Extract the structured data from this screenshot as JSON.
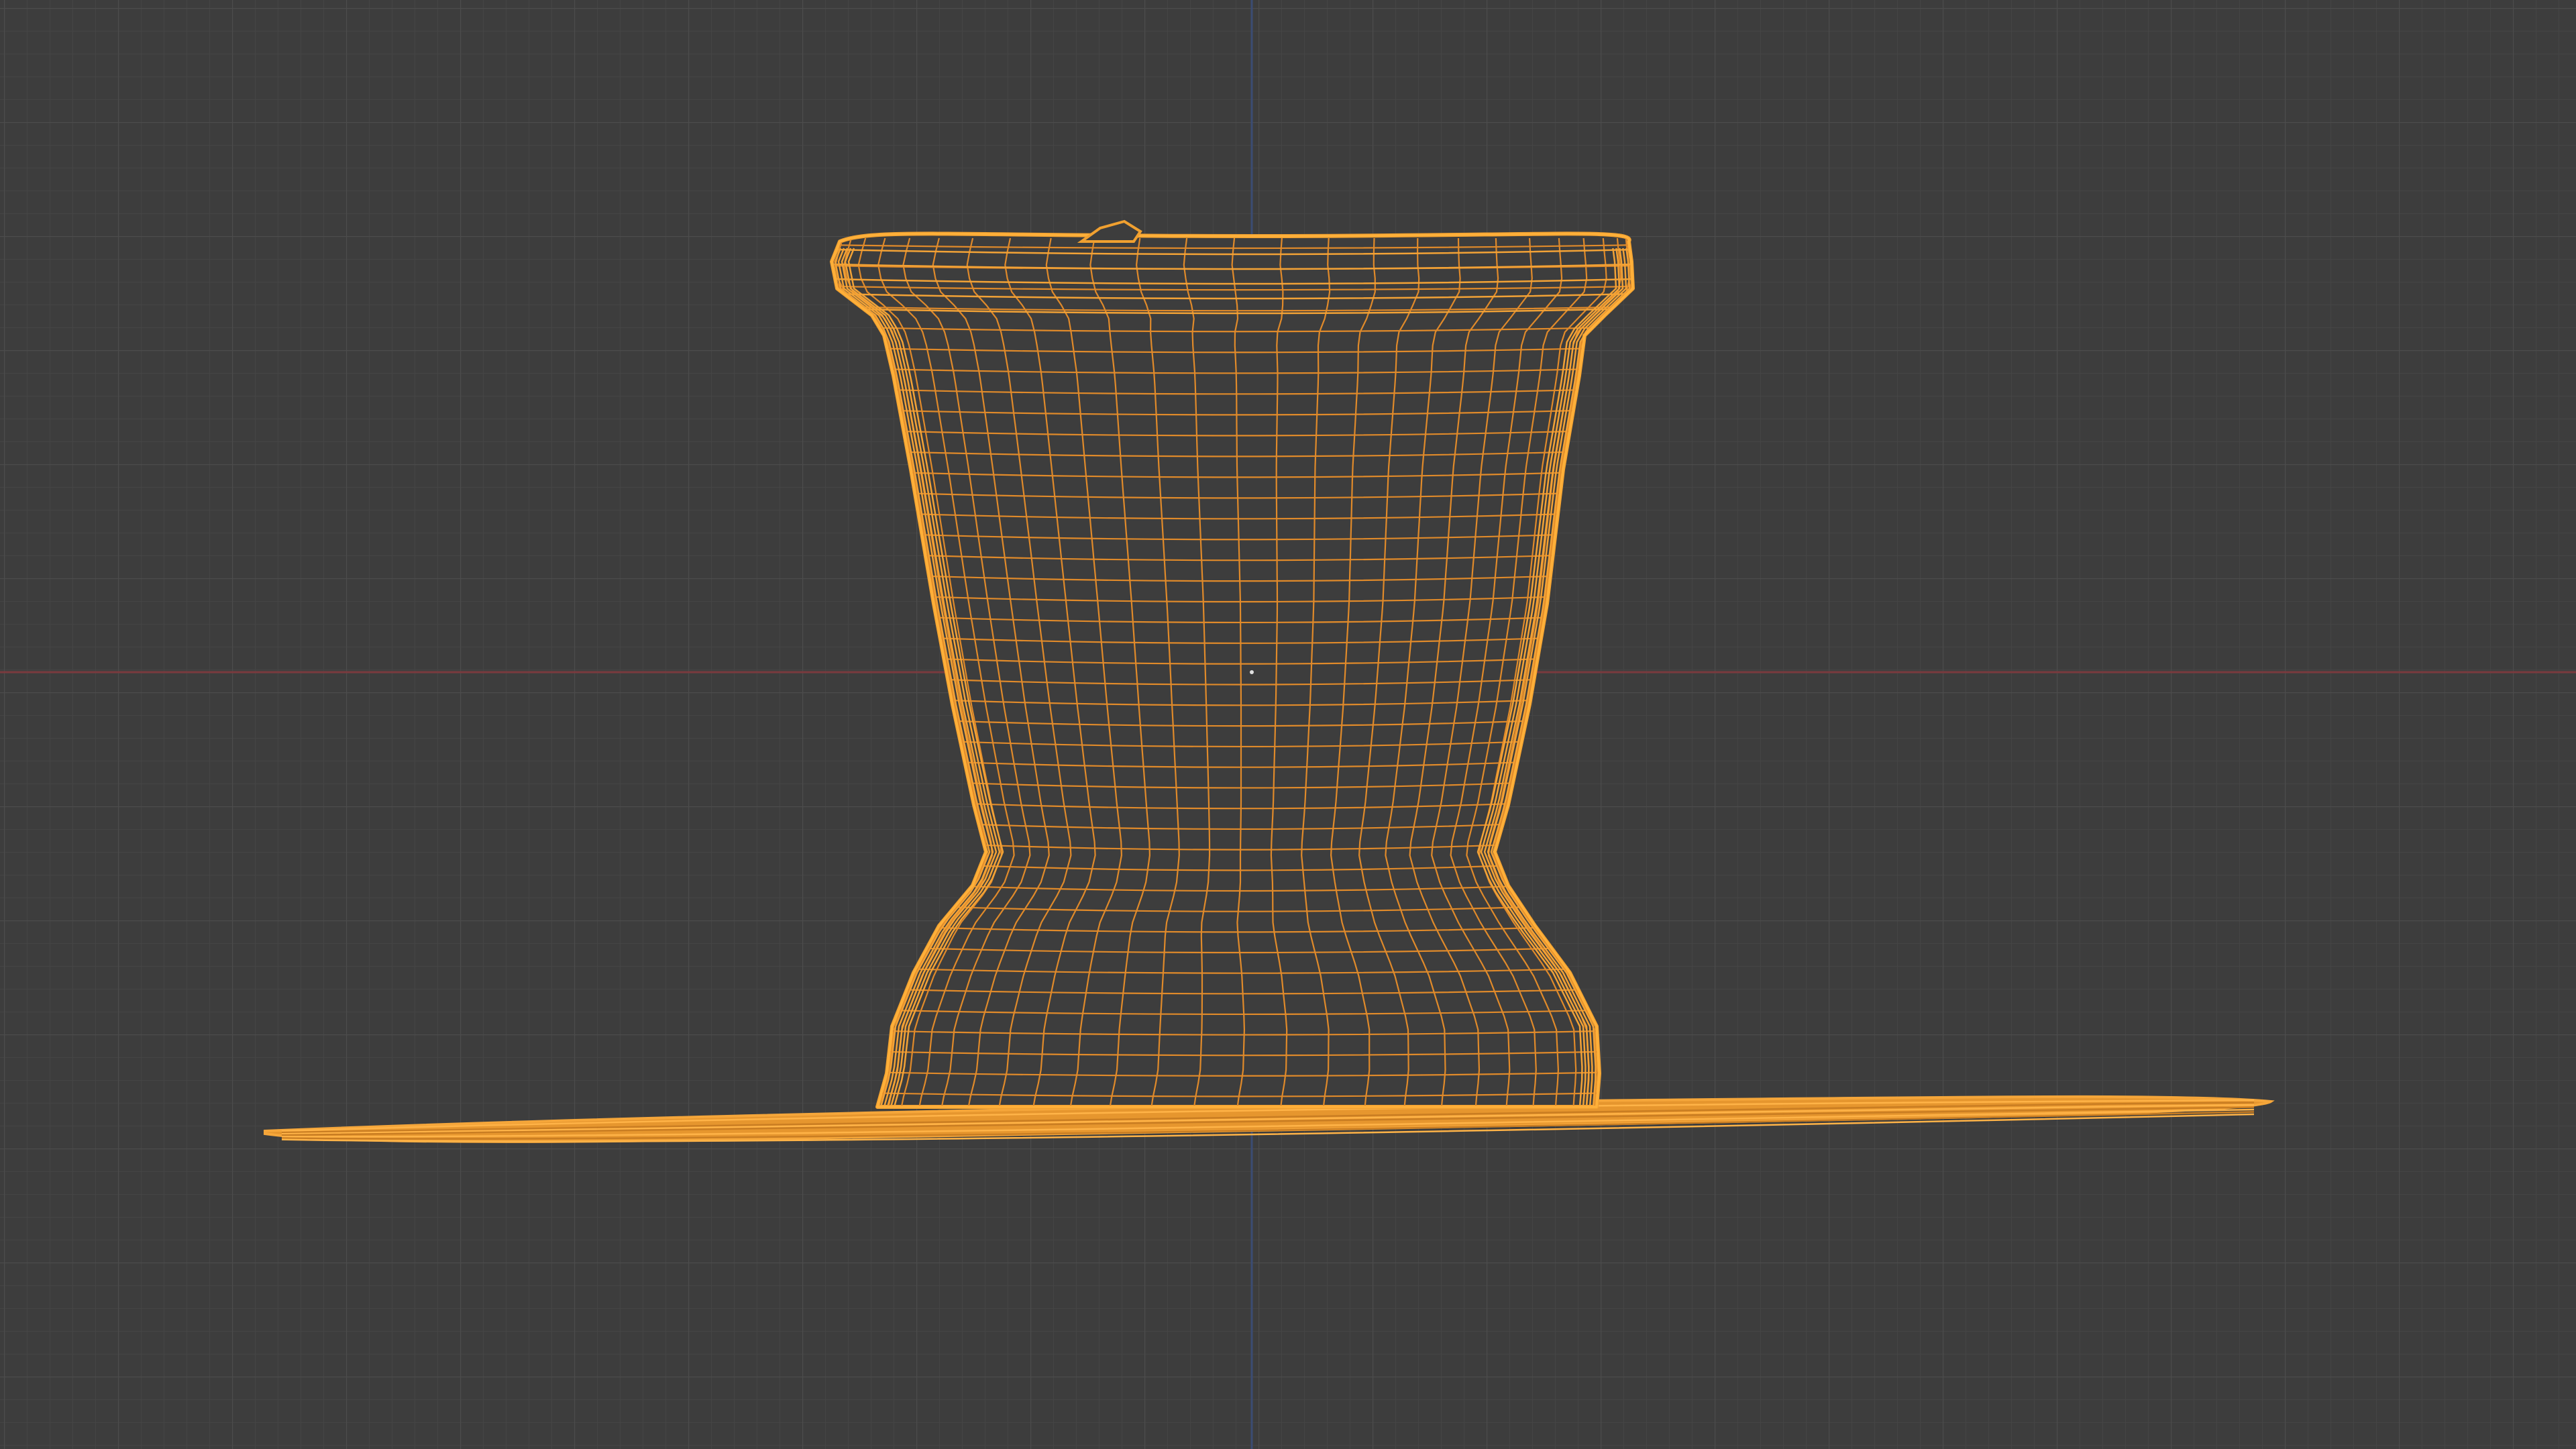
{
  "viewport": {
    "mode": "wireframe",
    "background_color": "#3d3d3d",
    "grid_minor_color": "#464646",
    "grid_major_color": "#4f4f4f",
    "x_axis_color": "#8a3a3a",
    "z_axis_color": "#3a4f7a",
    "selection_color": "#f0a030",
    "selection_wire_color": "#e08a2a"
  },
  "objects": [
    {
      "name": "vase-mesh",
      "selected": true
    },
    {
      "name": "base-plane",
      "selected": true
    }
  ]
}
